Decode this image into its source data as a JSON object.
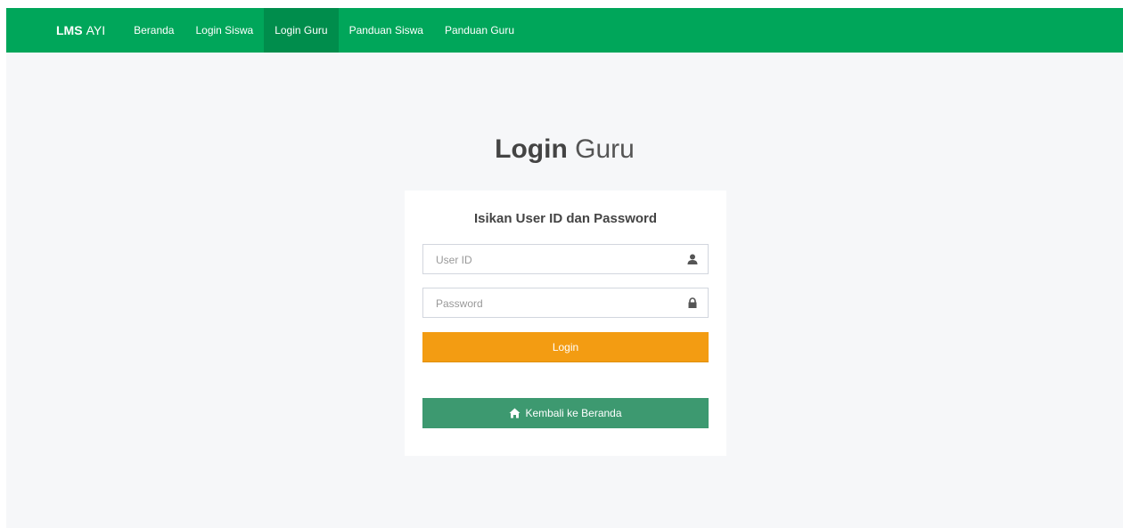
{
  "brand": {
    "bold": "LMS",
    "light": "AYI"
  },
  "nav": [
    {
      "label": "Beranda",
      "active": false
    },
    {
      "label": "Login Siswa",
      "active": false
    },
    {
      "label": "Login Guru",
      "active": true
    },
    {
      "label": "Panduan Siswa",
      "active": false
    },
    {
      "label": "Panduan Guru",
      "active": false
    }
  ],
  "page_title": {
    "bold": "Login",
    "light": "Guru"
  },
  "login_box": {
    "message": "Isikan User ID dan Password",
    "user_id": {
      "value": "",
      "placeholder": "User ID",
      "icon": "user-icon"
    },
    "password": {
      "value": "",
      "placeholder": "Password",
      "icon": "lock-icon"
    },
    "login_button": "Login",
    "home_button": {
      "label": "Kembali ke Beranda",
      "icon": "home-icon"
    }
  },
  "colors": {
    "navbar": "#00a65a",
    "navbar_active": "#008d4c",
    "login_button": "#f39c12",
    "home_button": "#3d9970",
    "page_background": "#f6f7f9"
  }
}
